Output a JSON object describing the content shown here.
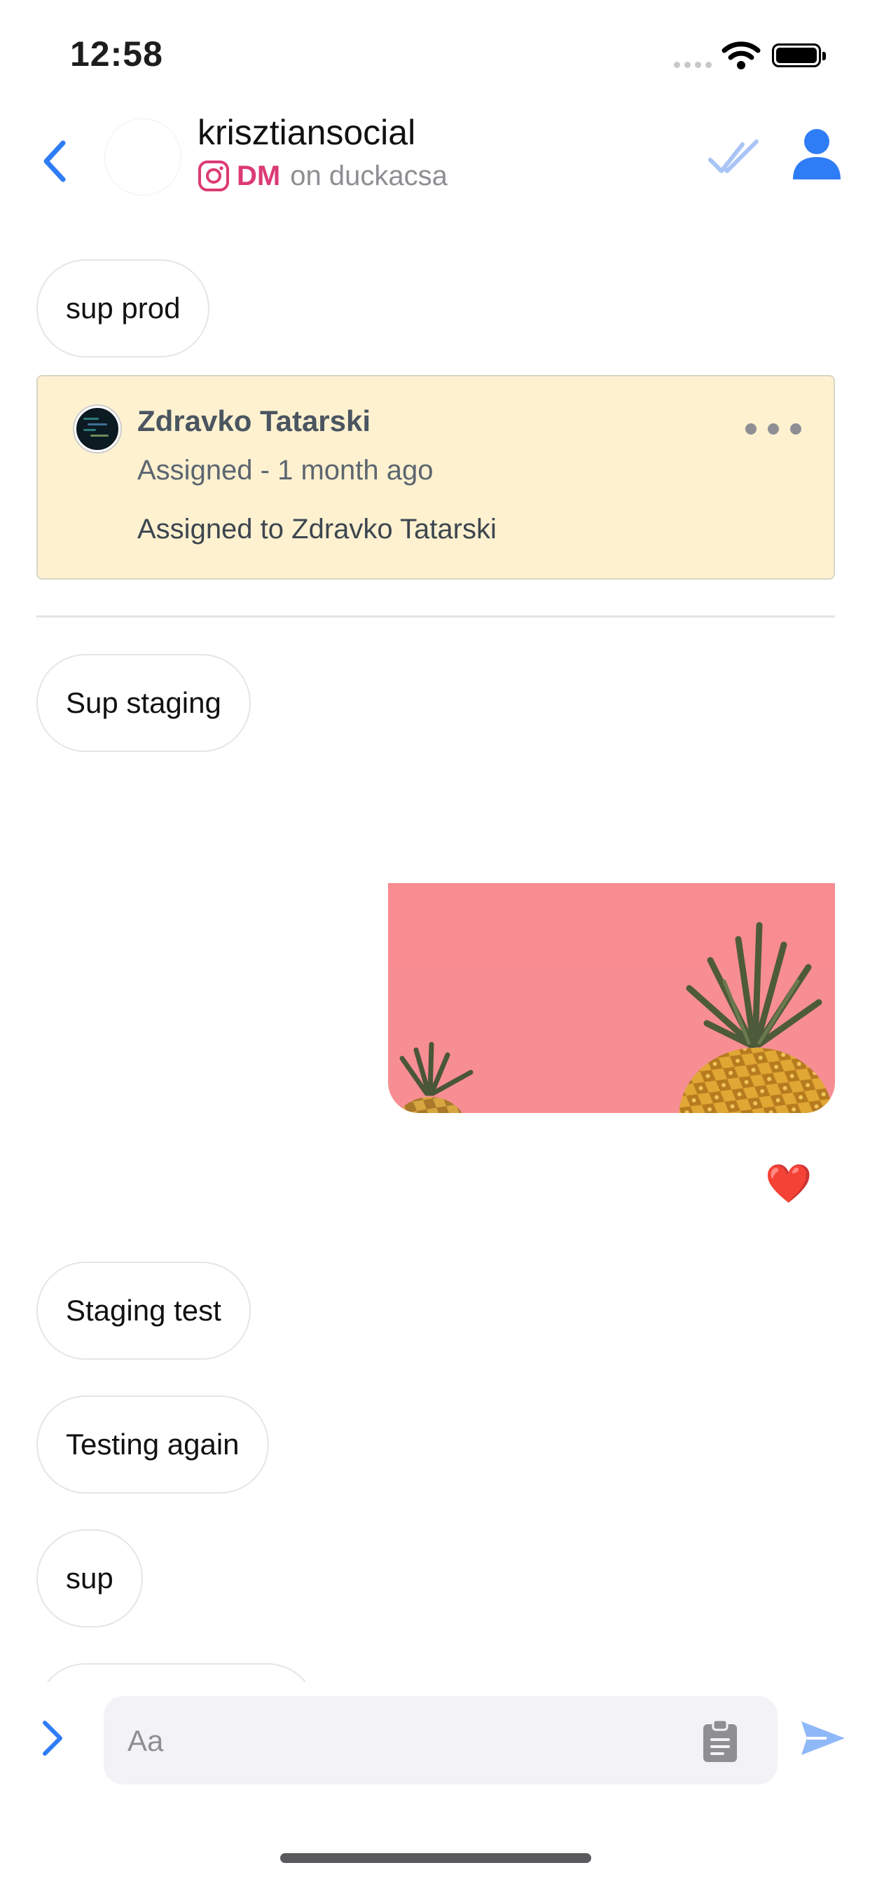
{
  "status_bar": {
    "time": "12:58"
  },
  "header": {
    "contact_name": "krisztiansocial",
    "channel_type": "DM",
    "channel_account": "on duckacsa",
    "icons": [
      "chevron-left-icon",
      "instagram-icon",
      "double-check-icon",
      "person-icon"
    ]
  },
  "messages": [
    {
      "text": "sup prod"
    },
    {
      "text": "Sup staging"
    },
    {
      "text": "Staging test"
    },
    {
      "text": "Testing again"
    },
    {
      "text": "sup"
    }
  ],
  "assignment": {
    "assignee": "Zdravko Tatarski",
    "meta": "Assigned - 1 month ago",
    "description": "Assigned to Zdravko Tatarski"
  },
  "image_message": {
    "subject": "pineapples on pink background",
    "reaction": "❤️"
  },
  "composer": {
    "placeholder": "Aa"
  },
  "colors": {
    "accent_blue": "#2f7df6",
    "instagram_pink": "#dc3a74",
    "assignment_bg": "#fdf1d0",
    "image_bg": "#f78e93"
  }
}
